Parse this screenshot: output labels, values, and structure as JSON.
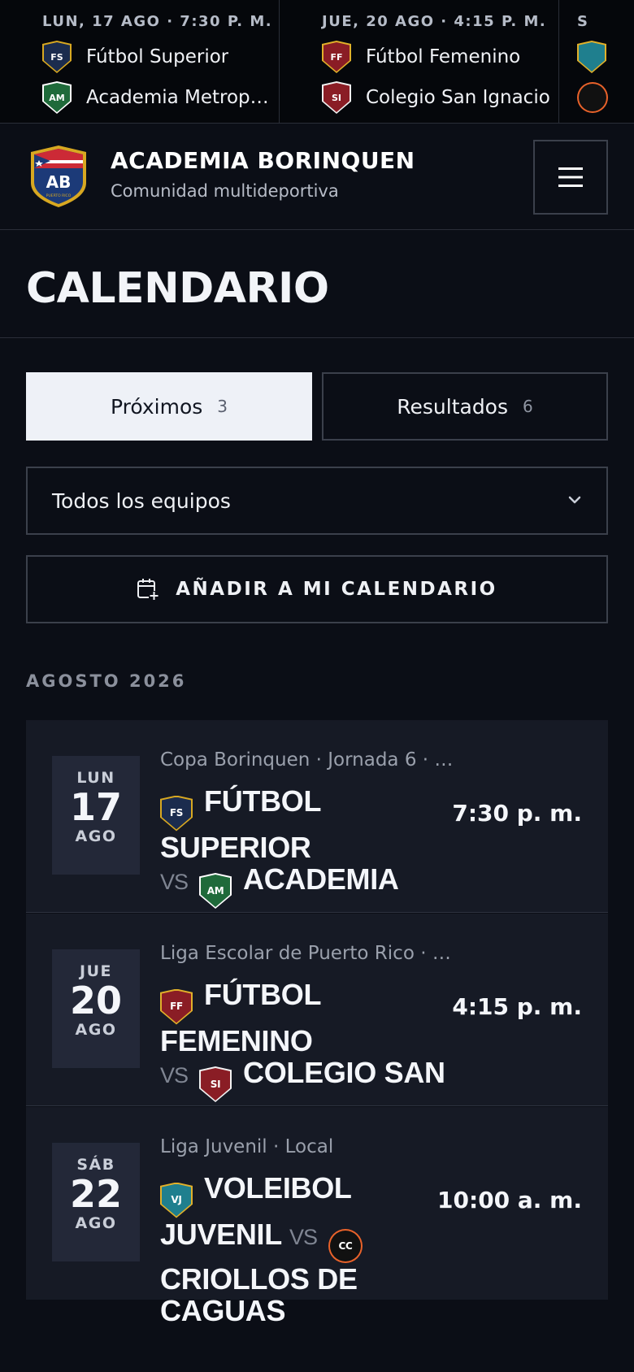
{
  "ticker": [
    {
      "date": "LUN, 17 AGO · 7:30 P. M.",
      "home": {
        "abbr": "FS",
        "name": "Fútbol Superior"
      },
      "away": {
        "abbr": "AM",
        "name": "Academia Metropolitana"
      }
    },
    {
      "date": "JUE, 20 AGO · 4:15 P. M.",
      "home": {
        "abbr": "FF",
        "name": "Fútbol Femenino"
      },
      "away": {
        "abbr": "SI",
        "name": "Colegio San Ignacio"
      }
    },
    {
      "date": "S"
    }
  ],
  "header": {
    "logo_abbr": "AB",
    "logo_ribbon": "PUERTO RICO",
    "title": "ACADEMIA BORINQUEN",
    "subtitle": "Comunidad multideportiva",
    "menu_icon": "hamburger-icon"
  },
  "page": {
    "title": "CALENDARIO"
  },
  "tabs": [
    {
      "label": "Próximos",
      "count": "3",
      "active": true
    },
    {
      "label": "Resultados",
      "count": "6",
      "active": false
    }
  ],
  "filter": {
    "selected": "Todos los equipos"
  },
  "calendar_button": {
    "label": "AÑADIR A MI CALENDARIO",
    "icon": "calendar-add-icon"
  },
  "month_label": "AGOSTO 2026",
  "matches": [
    {
      "dow": "LUN",
      "day": "17",
      "month": "AGO",
      "competition": "Copa Borinquen · Jornada 6 · …",
      "home_abbr": "FS",
      "home": "FÚTBOL SUPERIOR",
      "vs": "VS",
      "away_abbr": "AM",
      "away": "ACADEMIA METROPOLITANA",
      "time": "7:30 p. m."
    },
    {
      "dow": "JUE",
      "day": "20",
      "month": "AGO",
      "competition": "Liga Escolar de Puerto Rico · …",
      "home_abbr": "FF",
      "home": "FÚTBOL FEMENINO",
      "vs": "VS",
      "away_abbr": "SI",
      "away": "COLEGIO SAN IGNACIO",
      "time": "4:15 p. m."
    },
    {
      "dow": "SÁB",
      "day": "22",
      "month": "AGO",
      "competition": "Liga Juvenil · Local",
      "home_abbr": "VJ",
      "home": "VOLEIBOL JUVENIL",
      "vs": "VS",
      "away_abbr": "CC",
      "away": "CRIOLLOS DE CAGUAS",
      "time": "10:00 a. m."
    }
  ]
}
